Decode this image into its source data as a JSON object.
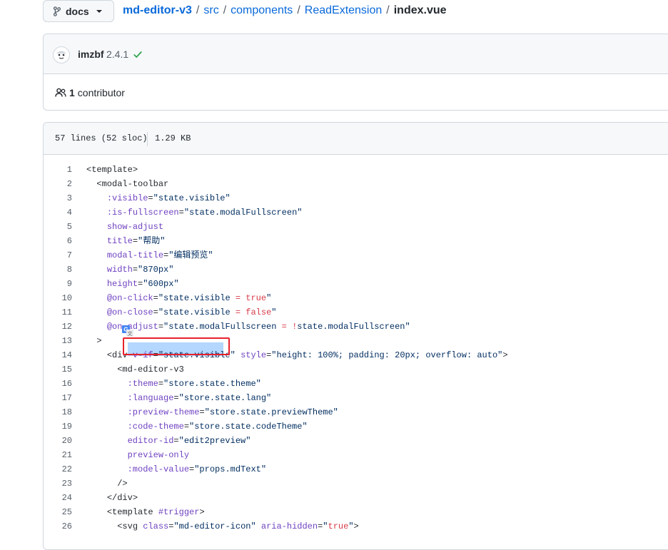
{
  "branch": {
    "name": "docs"
  },
  "breadcrumb": {
    "repo": "md-editor-v3",
    "parts": [
      "src",
      "components",
      "ReadExtension"
    ],
    "separator": "/",
    "file": "index.vue"
  },
  "commit": {
    "author": "imzbf",
    "version": "2.4.1",
    "status_icon": "check-icon",
    "status_color": "#2da44e"
  },
  "contributors": {
    "count": "1",
    "label": "contributor"
  },
  "file_info": {
    "lines": "57 lines (52 sloc)",
    "size": "1.29 KB"
  },
  "code_lines": [
    {
      "n": "1",
      "src": "<template>"
    },
    {
      "n": "2",
      "src": "  <modal-toolbar"
    },
    {
      "n": "3",
      "src": "    :visible=\"state.visible\""
    },
    {
      "n": "4",
      "src": "    :is-fullscreen=\"state.modalFullscreen\""
    },
    {
      "n": "5",
      "src": "    show-adjust"
    },
    {
      "n": "6",
      "src": "    title=\"帮助\""
    },
    {
      "n": "7",
      "src": "    modal-title=\"编辑预览\""
    },
    {
      "n": "8",
      "src": "    width=\"870px\""
    },
    {
      "n": "9",
      "src": "    height=\"600px\""
    },
    {
      "n": "10",
      "src": "    @on-click=\"state.visible = true\""
    },
    {
      "n": "11",
      "src": "    @on-close=\"state.visible = false\""
    },
    {
      "n": "12",
      "src": "    @on-adjust=\"state.modalFullscreen = !state.modalFullscreen\""
    },
    {
      "n": "13",
      "src": "  >"
    },
    {
      "n": "14",
      "src": "    <div v-if=\"state.visible\" style=\"height: 100%; padding: 20px; overflow: auto\">"
    },
    {
      "n": "15",
      "src": "      <md-editor-v3"
    },
    {
      "n": "16",
      "src": "        :theme=\"store.state.theme\""
    },
    {
      "n": "17",
      "src": "        :language=\"store.state.lang\""
    },
    {
      "n": "18",
      "src": "        :preview-theme=\"store.state.previewTheme\""
    },
    {
      "n": "19",
      "src": "        :code-theme=\"store.state.codeTheme\""
    },
    {
      "n": "20",
      "src": "        editor-id=\"edit2preview\""
    },
    {
      "n": "21",
      "src": "        preview-only"
    },
    {
      "n": "22",
      "src": "        :model-value=\"props.mdText\""
    },
    {
      "n": "23",
      "src": "      />"
    },
    {
      "n": "24",
      "src": "    </div>"
    },
    {
      "n": "25",
      "src": "    <template #trigger>"
    },
    {
      "n": "26",
      "src": "      <svg class=\"md-editor-icon\" aria-hidden=\"true\">"
    }
  ],
  "highlight": {
    "selected_text": "v-if=\"state.visible\"",
    "line": "14",
    "color": "#b3d7ff",
    "box_color": "#e8202a"
  },
  "translate_icon": "google-translate-icon"
}
